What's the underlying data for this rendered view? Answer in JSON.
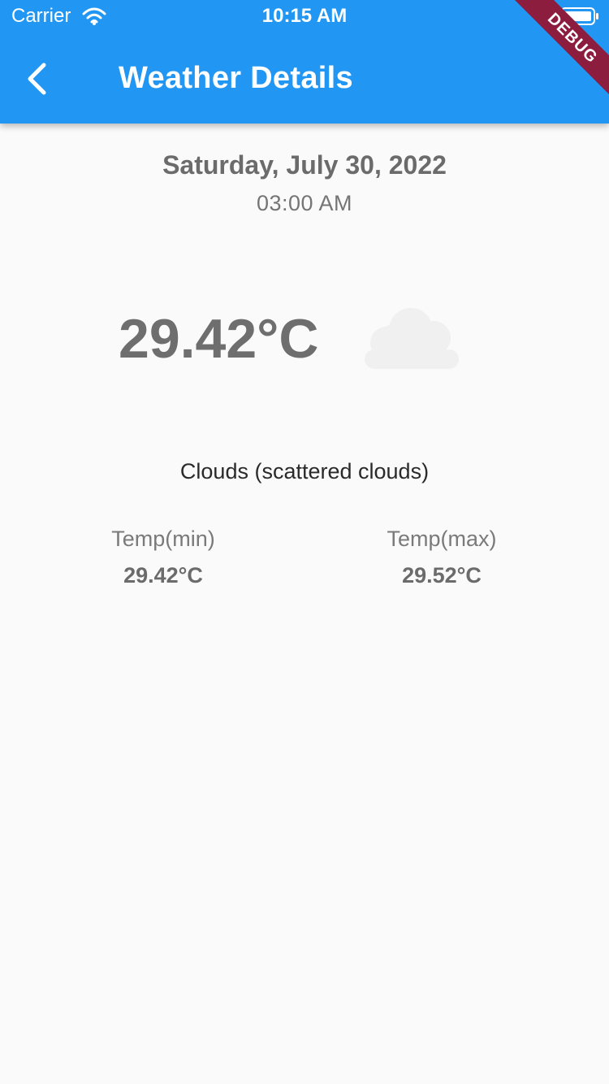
{
  "status_bar": {
    "carrier": "Carrier",
    "time": "10:15 AM",
    "wifi_icon": "wifi-icon",
    "battery_icon": "battery-icon"
  },
  "app_bar": {
    "title": "Weather Details",
    "back_icon": "chevron-left-icon",
    "background_color": "#2196f3"
  },
  "debug_banner": {
    "label": "DEBUG",
    "color": "#8c1d3f"
  },
  "weather": {
    "date": "Saturday, July 30, 2022",
    "time": "03:00 AM",
    "temperature": "29.42°C",
    "condition_icon": "cloud-icon",
    "description": "Clouds (scattered clouds)",
    "temp_min": {
      "label": "Temp(min)",
      "value": "29.42°C"
    },
    "temp_max": {
      "label": "Temp(max)",
      "value": "29.52°C"
    }
  }
}
